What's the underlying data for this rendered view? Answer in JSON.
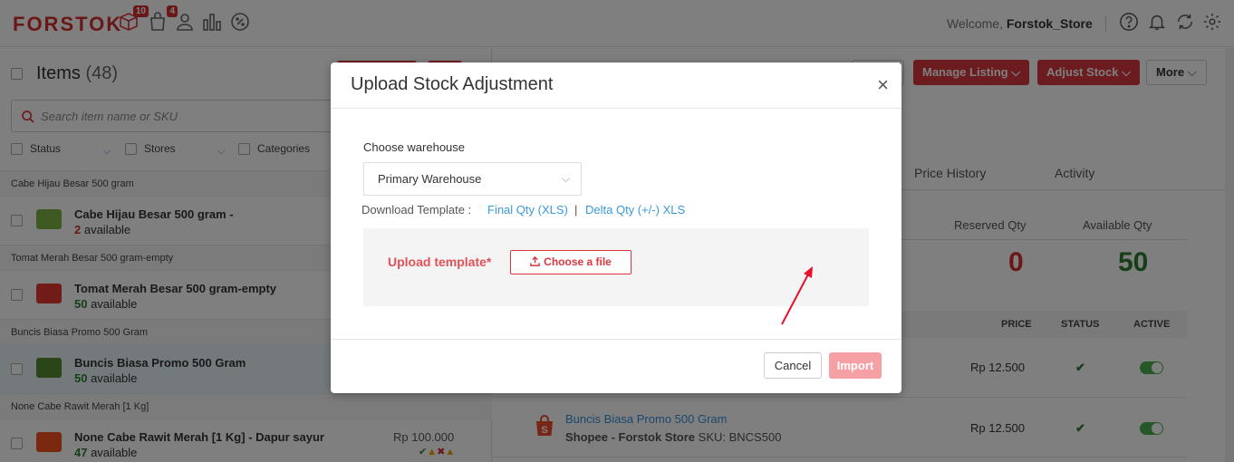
{
  "topbar": {
    "logo": "FORSTOK",
    "badges": {
      "inventory": "10",
      "orders": "4"
    },
    "welcome_prefix": "Welcome, ",
    "user": "Forstok_Store"
  },
  "items": {
    "title": "Items",
    "count": "(48)",
    "search_placeholder": "Search item name or SKU",
    "filters": [
      "Status",
      "Stores",
      "Categories"
    ],
    "groups": [
      {
        "header": "Cabe Hijau Besar 500 gram",
        "name": "Cabe Hijau Besar 500 gram -",
        "qty": "2",
        "avail": " available",
        "qty_color": "#d32f2f"
      },
      {
        "header": "Tomat Merah Besar 500 gram-empty",
        "name": "Tomat Merah Besar 500 gram-empty",
        "qty": "50",
        "avail": " available",
        "qty_color": "#2e7d32"
      },
      {
        "header": "Buncis Biasa Promo 500 Gram",
        "name": "Buncis Biasa Promo 500 Gram",
        "qty": "50",
        "avail": " available",
        "qty_color": "#2e7d32"
      },
      {
        "header": "None Cabe Rawit Merah [1 Kg]",
        "name": "None Cabe Rawit Merah [1 Kg] - Dapur sayur",
        "qty": "47",
        "avail": " available",
        "qty_color": "#2e7d32",
        "price": "Rp 100.000"
      }
    ]
  },
  "detail": {
    "buttons": {
      "manage": "Manage Listing",
      "adjust": "Adjust Stock",
      "more": "More"
    },
    "tabs": [
      "Price History",
      "Activity"
    ],
    "reserved_label": "Reserved Qty",
    "reserved_value": "0",
    "available_label": "Available Qty",
    "available_value": "50",
    "table_headers": {
      "price": "PRICE",
      "status": "STATUS",
      "active": "ACTIVE"
    },
    "rows": [
      {
        "price": "Rp  12.500"
      },
      {
        "listing_name": "Buncis Biasa Promo 500 Gram",
        "store": "Shopee - Forstok Store",
        "sku_label": "SKU: BNCS500",
        "price": "Rp  12.500"
      }
    ]
  },
  "modal": {
    "title": "Upload Stock Adjustment",
    "close": "×",
    "warehouse_label": "Choose warehouse",
    "warehouse_value": "Primary Warehouse",
    "download_label": "Download Template :",
    "link_final": "Final Qty (XLS)",
    "separator": "|",
    "link_delta": "Delta Qty (+/-) XLS",
    "upload_label": "Upload template*",
    "choose_file": "Choose a file",
    "cancel": "Cancel",
    "import": "Import"
  }
}
